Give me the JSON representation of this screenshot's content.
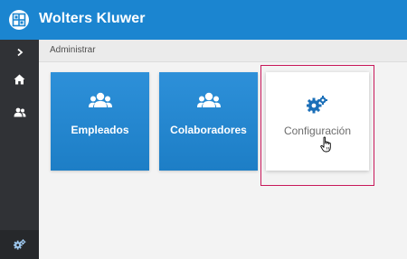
{
  "app": {
    "title": "Wolters Kluwer",
    "brand_color": "#1b85d0",
    "logo_icon": "wolters-kluwer-logo"
  },
  "sidebar": {
    "background": "#303236",
    "items": [
      {
        "name": "expand",
        "icon": "chevron-right-icon"
      },
      {
        "name": "home",
        "icon": "home-icon"
      },
      {
        "name": "users",
        "icon": "users-icon"
      },
      {
        "name": "settings",
        "icon": "cogs-icon"
      }
    ]
  },
  "breadcrumb": {
    "current": "Administrar"
  },
  "tiles": [
    {
      "label": "Empleados",
      "icon": "users-icon",
      "style": "blue"
    },
    {
      "label": "Colaboradores",
      "icon": "users-icon",
      "style": "blue"
    },
    {
      "label": "Configuración",
      "icon": "cogs-icon",
      "style": "white",
      "highlighted": true,
      "highlight_color": "#c8185a"
    }
  ]
}
